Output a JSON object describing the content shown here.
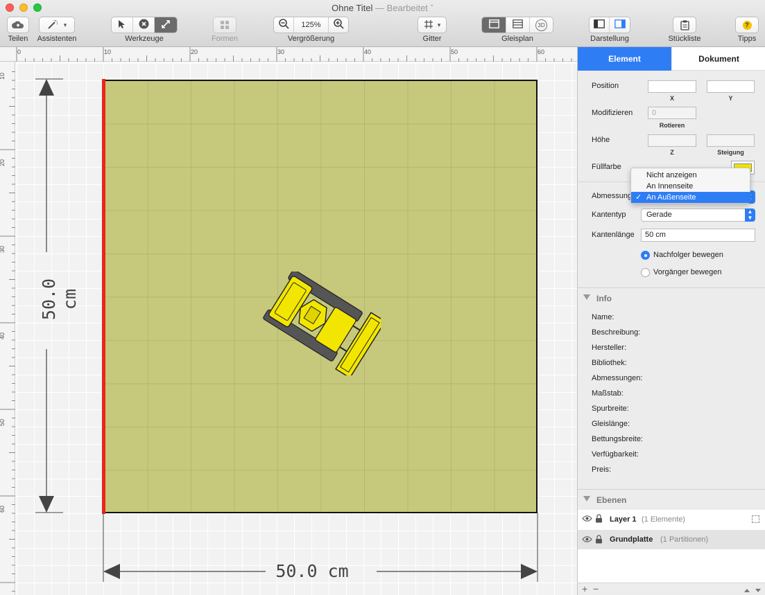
{
  "window": {
    "title": "Ohne Titel",
    "subtitle": "— Bearbeitet ˇ"
  },
  "toolbar": {
    "share": "Teilen",
    "assistants": "Assistenten",
    "tools": "Werkzeuge",
    "shapes": "Formen",
    "zoom_label": "Vergrößerung",
    "zoom_value": "125%",
    "grid": "Gitter",
    "trackplan": "Gleisplan",
    "display": "Darstellung",
    "partslist": "Stückliste",
    "tips": "Tipps",
    "view3d": "3D"
  },
  "ruler": {
    "h": [
      "0",
      "10",
      "20",
      "30",
      "40",
      "50",
      "60"
    ],
    "v": [
      "10",
      "20",
      "30",
      "40",
      "50",
      "60"
    ]
  },
  "canvas": {
    "dim_vertical": "50.0 cm",
    "dim_horizontal": "50.0 cm"
  },
  "panel": {
    "tab_element": "Element",
    "tab_document": "Dokument",
    "position": "Position",
    "x": "X",
    "y": "Y",
    "modify": "Modifizieren",
    "rotate_placeholder": "0",
    "rotate": "Rotieren",
    "height": "Höhe",
    "z": "Z",
    "slope": "Steigung",
    "fill": "Füllfarbe",
    "fill_color": "#f2e600",
    "dimension": "Abmessung",
    "edge_type": "Kantentyp",
    "edge_type_value": "Gerade",
    "edge_length": "Kantenlänge",
    "edge_length_value": "50 cm",
    "move_next": "Nachfolger bewegen",
    "move_prev": "Vorgänger bewegen",
    "menu": [
      "Nicht anzeigen",
      "An Innenseite",
      "An Außenseite"
    ],
    "menu_selected_check": "✓"
  },
  "info": {
    "title": "Info",
    "fields": [
      "Name:",
      "Beschreibung:",
      "Hersteller:",
      "Bibliothek:",
      "Abmessungen:",
      "Maßstab:",
      "Spurbreite:",
      "Gleislänge:",
      "Bettungsbreite:",
      "Verfügbarkeit:",
      "Preis:"
    ]
  },
  "layers": {
    "title": "Ebenen",
    "rows": [
      {
        "name": "Layer 1",
        "count": "(1 Elemente)"
      },
      {
        "name": "Grundplatte",
        "count": "(1 Partitionen)"
      }
    ],
    "add": "+",
    "remove": "−"
  },
  "colors": {
    "accent": "#2f7df5",
    "plate": "#c6c97b",
    "edge": "#e8261a",
    "model": "#f2e600"
  }
}
